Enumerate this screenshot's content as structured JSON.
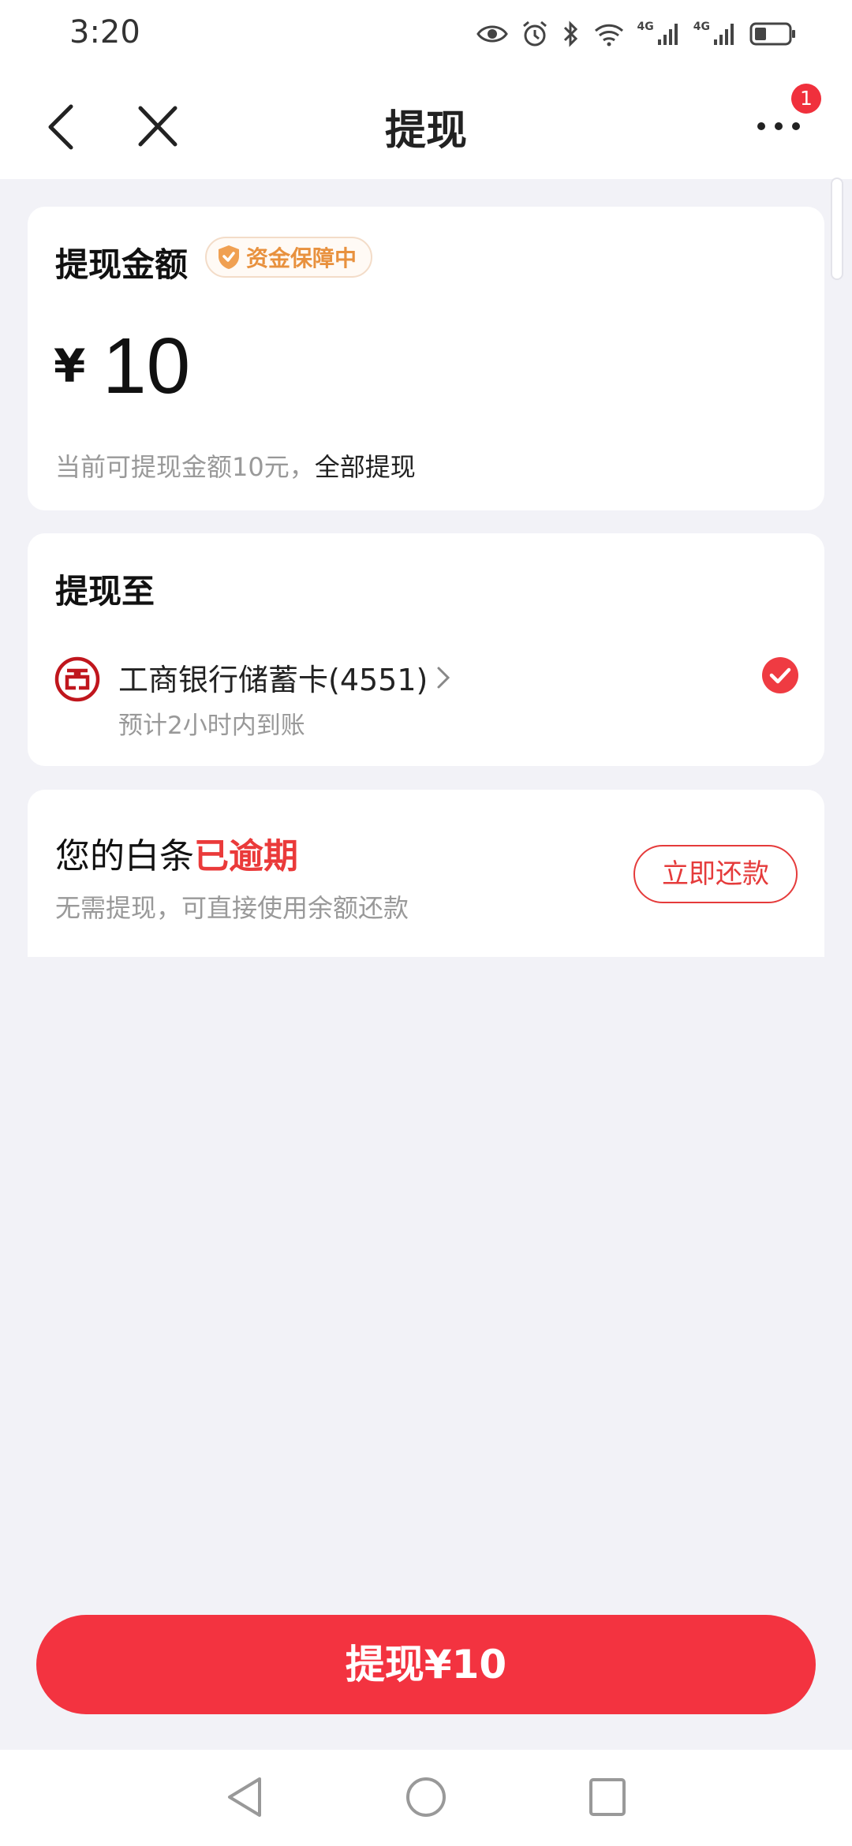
{
  "status_bar": {
    "time": "3:20",
    "network_1": "4G",
    "network_2": "4G"
  },
  "header": {
    "title": "提现",
    "more_badge": "1"
  },
  "amount_card": {
    "title": "提现金额",
    "badge": "资金保障中",
    "currency": "¥",
    "amount": "10",
    "hint": "当前可提现金额10元，",
    "withdraw_all": "全部提现"
  },
  "destination_card": {
    "title": "提现至",
    "bank_name": "工商银行储蓄卡(4551)",
    "arrival": "预计2小时内到账",
    "selected": true
  },
  "repay_card": {
    "title_prefix": "您的白条",
    "title_status": "已逾期",
    "subtitle": "无需提现，可直接使用余额还款",
    "button": "立即还款"
  },
  "submit_button": "提现¥10",
  "colors": {
    "accent": "#f33340",
    "badge_orange": "#e8913e",
    "bank_red": "#c0161d",
    "background": "#f2f2f7"
  },
  "icons": {
    "status": [
      "eye-icon",
      "alarm-icon",
      "bluetooth-icon",
      "wifi-icon",
      "signal-icon",
      "battery-icon"
    ],
    "nav": [
      "back-arrow-icon",
      "close-icon",
      "more-dots-icon"
    ],
    "system": [
      "nav-back-icon",
      "nav-home-icon",
      "nav-recents-icon"
    ]
  }
}
